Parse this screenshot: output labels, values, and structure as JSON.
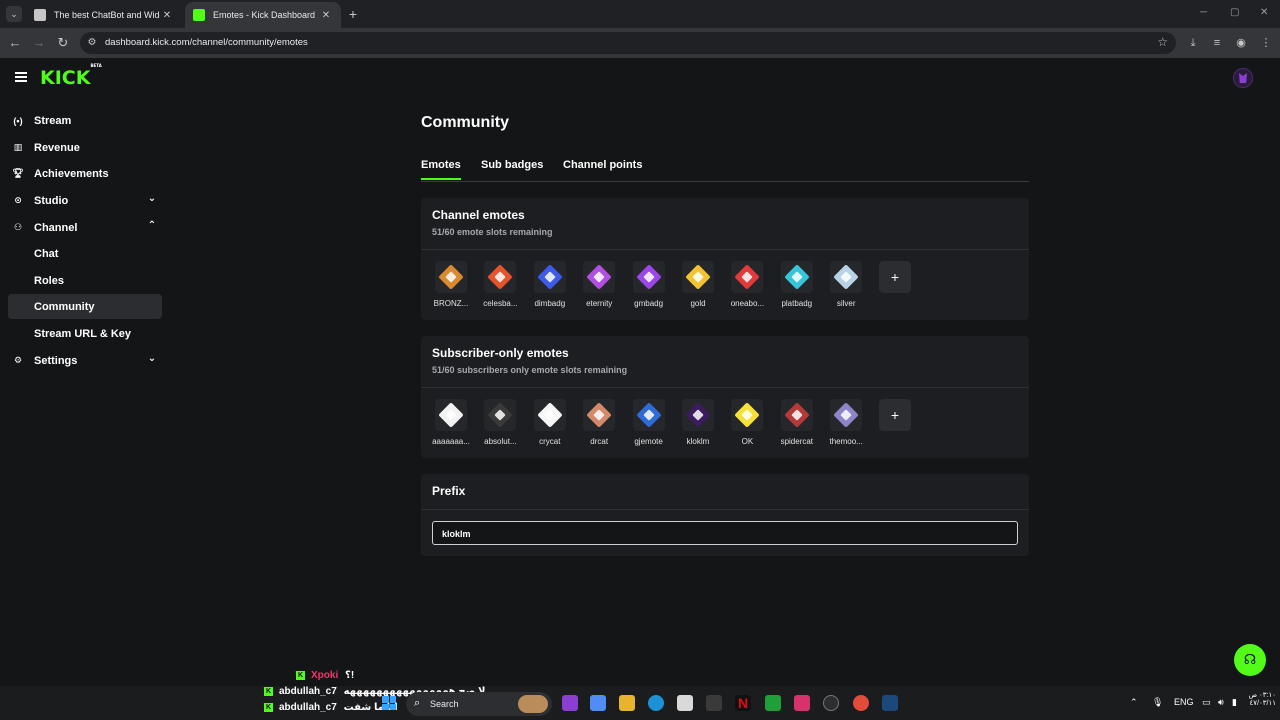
{
  "browser": {
    "tabs": [
      {
        "title": "The best ChatBot and Widgets",
        "close": "✕"
      },
      {
        "title": "Emotes - Kick Dashboard",
        "close": "✕"
      }
    ],
    "new_tab": "+",
    "url": "dashboard.kick.com/channel/community/emotes"
  },
  "header": {
    "logo": "KICK",
    "logo_badge": "BETA"
  },
  "sidebar": {
    "items": [
      {
        "label": "Stream",
        "icon": "broadcast-icon"
      },
      {
        "label": "Revenue",
        "icon": "revenue-icon"
      },
      {
        "label": "Achievements",
        "icon": "trophy-icon"
      },
      {
        "label": "Studio",
        "icon": "studio-icon"
      },
      {
        "label": "Channel",
        "icon": "channel-icon"
      },
      {
        "label": "Chat"
      },
      {
        "label": "Roles"
      },
      {
        "label": "Community"
      },
      {
        "label": "Stream URL & Key"
      },
      {
        "label": "Settings",
        "icon": "gear-icon"
      }
    ]
  },
  "main": {
    "title": "Community",
    "tabs": [
      {
        "label": "Emotes"
      },
      {
        "label": "Sub badges"
      },
      {
        "label": "Channel points"
      }
    ],
    "channel_emotes": {
      "title": "Channel emotes",
      "subtitle": "51/60 emote slots remaining",
      "emotes": [
        {
          "name": "BRONZ...",
          "color": "#d9892f"
        },
        {
          "name": "celesba...",
          "color": "#e5532c"
        },
        {
          "name": "dimbadg",
          "color": "#3d5ae8"
        },
        {
          "name": "eternity",
          "color": "#b14fe0"
        },
        {
          "name": "gmbadg",
          "color": "#9b46e6"
        },
        {
          "name": "gold",
          "color": "#f2c230"
        },
        {
          "name": "oneabo...",
          "color": "#e23a3a"
        },
        {
          "name": "platbadg",
          "color": "#35c6d9"
        },
        {
          "name": "silver",
          "color": "#b9d3e6"
        }
      ],
      "add_label": "+"
    },
    "subscriber_emotes": {
      "title": "Subscriber-only emotes",
      "subtitle": "51/60 subscribers only emote slots remaining",
      "emotes": [
        {
          "name": "aaaaaaa...",
          "color": "#f2f2f2"
        },
        {
          "name": "absolut...",
          "color": "#3a3a3a"
        },
        {
          "name": "crycat",
          "color": "#f7f7f7"
        },
        {
          "name": "drcat",
          "color": "#d48a6a"
        },
        {
          "name": "gjemote",
          "color": "#2f6bd6"
        },
        {
          "name": "kloklm",
          "color": "#3b1c5e"
        },
        {
          "name": "OK",
          "color": "#f4e23a"
        },
        {
          "name": "spidercat",
          "color": "#b43a3a"
        },
        {
          "name": "themoo...",
          "color": "#8c86c8"
        }
      ],
      "add_label": "+"
    },
    "prefix": {
      "title": "Prefix",
      "value": "kloklm"
    }
  },
  "chat_overlay": {
    "lines": [
      {
        "user": "Xpoki",
        "message": "؟!",
        "user_color": "#ff2f6d"
      },
      {
        "user": "abdullah_c7",
        "message": "لا صح ههههههههههههههههه",
        "user_color": "#ffffff"
      },
      {
        "user": "abdullah_c7",
        "message": "انا ما شفت",
        "user_color": "#ffffff"
      }
    ]
  },
  "taskbar": {
    "search_placeholder": "Search",
    "language": "ENG",
    "time": "٠٣:١٠ ص",
    "date": "٤٧/٠٣/١١"
  }
}
